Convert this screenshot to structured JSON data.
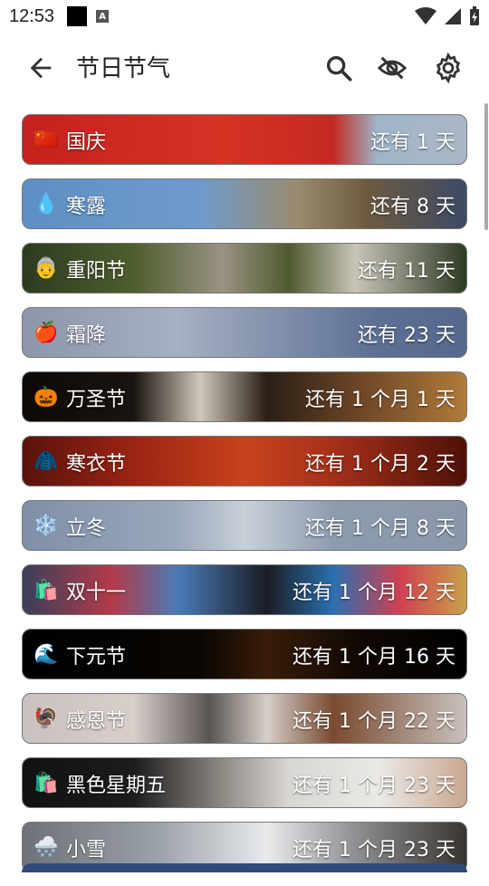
{
  "status": {
    "time": "12:53",
    "notif_letter": "A"
  },
  "app_bar": {
    "title": "节日节气"
  },
  "holidays": [
    {
      "name": "国庆",
      "emoji": "🇨🇳",
      "countdown": "还有 1 天",
      "bg": "linear-gradient(90deg,#c8201e 0%,#d63224 45%,#c42a22 70%,#9fb5c9 80%,#aab7c5 100%)"
    },
    {
      "name": "寒露",
      "emoji": "💧",
      "countdown": "还有 8 天",
      "bg": "linear-gradient(90deg,#5d8fc4 0%,#6f9bcc 40%,#9a8a6e 62%,#6b5a40 78%,#3d4a66 100%)"
    },
    {
      "name": "重阳节",
      "emoji": "👵",
      "countdown": "还有 11 天",
      "bg": "linear-gradient(90deg,#2c3b1f 0%,#4e5e2e 25%,#9a9283 45%,#4f5a2f 60%,#c9c4b8 75%,#2d3a24 100%)"
    },
    {
      "name": "霜降",
      "emoji": "🍎",
      "countdown": "还有 23 天",
      "bg": "linear-gradient(90deg,#8d96a8 0%,#a6b0c4 35%,#7d8ca8 60%,#5d6f95 80%,#56688e 100%)"
    },
    {
      "name": "万圣节",
      "emoji": "🎃",
      "countdown": "还有 1 个月 1 天",
      "bg": "linear-gradient(90deg,#0c0907 0%,#1a1410 25%,#cfc7b9 40%,#2a1f16 55%,#6b4426 75%,#b07a3a 100%)"
    },
    {
      "name": "寒衣节",
      "emoji": "🧥",
      "countdown": "还有 1 个月 2 天",
      "bg": "linear-gradient(90deg,#5a120c 0%,#9a2413 25%,#c8431d 50%,#a5301a 70%,#4e1108 100%)"
    },
    {
      "name": "立冬",
      "emoji": "❄️",
      "countdown": "还有 1 个月 8 天",
      "bg": "linear-gradient(90deg,#7f8fa8 0%,#9aa8bc 35%,#c8d0d8 50%,#8d9bb0 70%,#8a97ab 100%)"
    },
    {
      "name": "双十一",
      "emoji": "🛍️",
      "countdown": "还有 1 个月 12 天",
      "bg": "linear-gradient(90deg,#3a3f59 0%,#b33a4a 20%,#4a7bb8 35%,#1a1d26 55%,#2b6fb0 70%,#d04050 85%,#c9a04a 100%)"
    },
    {
      "name": "下元节",
      "emoji": "🌊",
      "countdown": "还有 1 个月 16 天",
      "bg": "linear-gradient(90deg,#000000 0%,#0a0603 40%,#3a1c08 55%,#120904 75%,#000000 100%)"
    },
    {
      "name": "感恩节",
      "emoji": "🦃",
      "countdown": "还有 1 个月 22 天",
      "bg": "linear-gradient(90deg,#c9c1bd 0%,#d8cfcb 25%,#5a5450 42%,#d6cec9 55%,#7a4a30 70%,#c9c1bd 100%)"
    },
    {
      "name": "黑色星期五",
      "emoji": "🛍️",
      "countdown": "还有 1 个月 23 天",
      "bg": "linear-gradient(90deg,#111111 0%,#1c1c1c 25%,#8f8984 45%,#d8d6d3 60%,#ebe9e6 80%,#c9a891 100%)"
    },
    {
      "name": "小雪",
      "emoji": "🌨️",
      "countdown": "还有 1 个月 23 天",
      "bg": "linear-gradient(90deg,#6e7278 0%,#9aa0a8 30%,#e8eaec 55%,#8e8f92 75%,#3a3530 100%)"
    }
  ]
}
